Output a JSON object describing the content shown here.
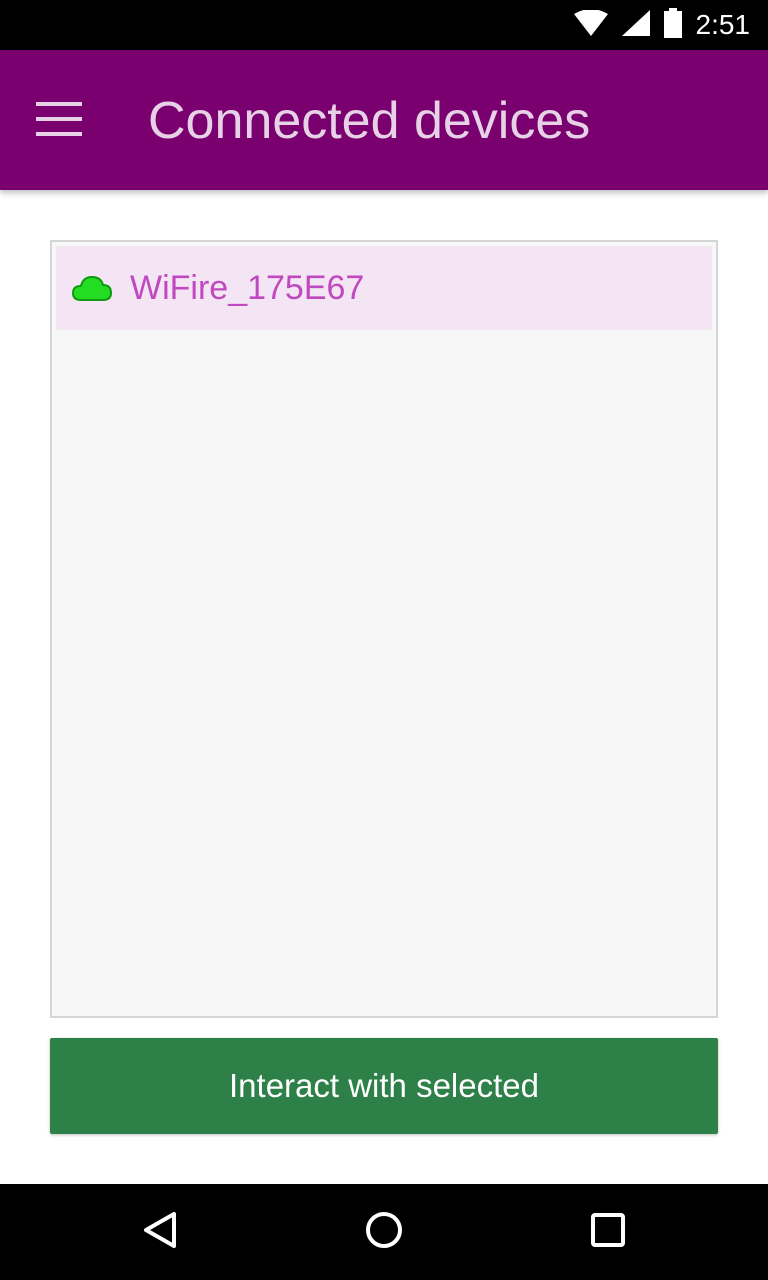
{
  "status_bar": {
    "time": "2:51",
    "icons": [
      "wifi-signal-icon",
      "cellular-signal-icon",
      "battery-icon"
    ]
  },
  "app_bar": {
    "menu_icon": "hamburger-menu-icon",
    "title": "Connected devices",
    "background_color": "#7a0070"
  },
  "devices": [
    {
      "name": "WiFire_175E67",
      "icon": "cloud-icon",
      "icon_color": "#22dd22",
      "selected": true
    }
  ],
  "actions": {
    "interact_label": "Interact with selected",
    "button_color": "#2d8047"
  },
  "nav_bar": {
    "icons": [
      "back-icon",
      "home-icon",
      "recents-icon"
    ]
  }
}
